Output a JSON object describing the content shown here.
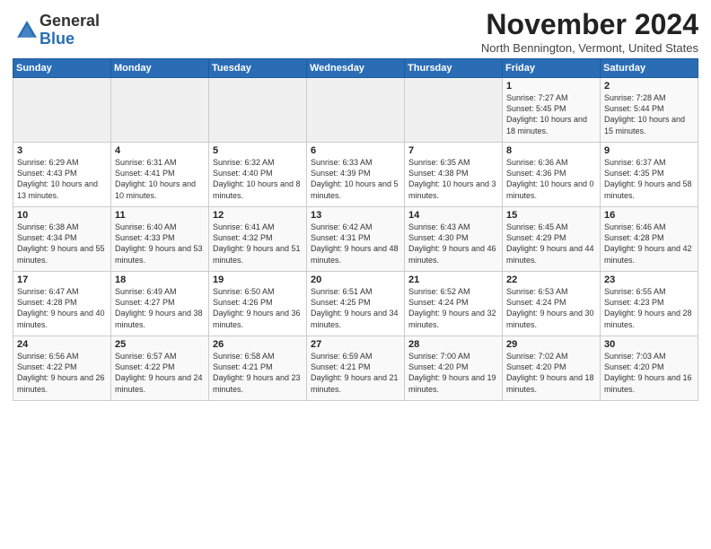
{
  "logo": {
    "general": "General",
    "blue": "Blue"
  },
  "title": "November 2024",
  "subtitle": "North Bennington, Vermont, United States",
  "days_header": [
    "Sunday",
    "Monday",
    "Tuesday",
    "Wednesday",
    "Thursday",
    "Friday",
    "Saturday"
  ],
  "weeks": [
    [
      {
        "num": "",
        "info": ""
      },
      {
        "num": "",
        "info": ""
      },
      {
        "num": "",
        "info": ""
      },
      {
        "num": "",
        "info": ""
      },
      {
        "num": "",
        "info": ""
      },
      {
        "num": "1",
        "info": "Sunrise: 7:27 AM\nSunset: 5:45 PM\nDaylight: 10 hours and 18 minutes."
      },
      {
        "num": "2",
        "info": "Sunrise: 7:28 AM\nSunset: 5:44 PM\nDaylight: 10 hours and 15 minutes."
      }
    ],
    [
      {
        "num": "3",
        "info": "Sunrise: 6:29 AM\nSunset: 4:43 PM\nDaylight: 10 hours and 13 minutes."
      },
      {
        "num": "4",
        "info": "Sunrise: 6:31 AM\nSunset: 4:41 PM\nDaylight: 10 hours and 10 minutes."
      },
      {
        "num": "5",
        "info": "Sunrise: 6:32 AM\nSunset: 4:40 PM\nDaylight: 10 hours and 8 minutes."
      },
      {
        "num": "6",
        "info": "Sunrise: 6:33 AM\nSunset: 4:39 PM\nDaylight: 10 hours and 5 minutes."
      },
      {
        "num": "7",
        "info": "Sunrise: 6:35 AM\nSunset: 4:38 PM\nDaylight: 10 hours and 3 minutes."
      },
      {
        "num": "8",
        "info": "Sunrise: 6:36 AM\nSunset: 4:36 PM\nDaylight: 10 hours and 0 minutes."
      },
      {
        "num": "9",
        "info": "Sunrise: 6:37 AM\nSunset: 4:35 PM\nDaylight: 9 hours and 58 minutes."
      }
    ],
    [
      {
        "num": "10",
        "info": "Sunrise: 6:38 AM\nSunset: 4:34 PM\nDaylight: 9 hours and 55 minutes."
      },
      {
        "num": "11",
        "info": "Sunrise: 6:40 AM\nSunset: 4:33 PM\nDaylight: 9 hours and 53 minutes."
      },
      {
        "num": "12",
        "info": "Sunrise: 6:41 AM\nSunset: 4:32 PM\nDaylight: 9 hours and 51 minutes."
      },
      {
        "num": "13",
        "info": "Sunrise: 6:42 AM\nSunset: 4:31 PM\nDaylight: 9 hours and 48 minutes."
      },
      {
        "num": "14",
        "info": "Sunrise: 6:43 AM\nSunset: 4:30 PM\nDaylight: 9 hours and 46 minutes."
      },
      {
        "num": "15",
        "info": "Sunrise: 6:45 AM\nSunset: 4:29 PM\nDaylight: 9 hours and 44 minutes."
      },
      {
        "num": "16",
        "info": "Sunrise: 6:46 AM\nSunset: 4:28 PM\nDaylight: 9 hours and 42 minutes."
      }
    ],
    [
      {
        "num": "17",
        "info": "Sunrise: 6:47 AM\nSunset: 4:28 PM\nDaylight: 9 hours and 40 minutes."
      },
      {
        "num": "18",
        "info": "Sunrise: 6:49 AM\nSunset: 4:27 PM\nDaylight: 9 hours and 38 minutes."
      },
      {
        "num": "19",
        "info": "Sunrise: 6:50 AM\nSunset: 4:26 PM\nDaylight: 9 hours and 36 minutes."
      },
      {
        "num": "20",
        "info": "Sunrise: 6:51 AM\nSunset: 4:25 PM\nDaylight: 9 hours and 34 minutes."
      },
      {
        "num": "21",
        "info": "Sunrise: 6:52 AM\nSunset: 4:24 PM\nDaylight: 9 hours and 32 minutes."
      },
      {
        "num": "22",
        "info": "Sunrise: 6:53 AM\nSunset: 4:24 PM\nDaylight: 9 hours and 30 minutes."
      },
      {
        "num": "23",
        "info": "Sunrise: 6:55 AM\nSunset: 4:23 PM\nDaylight: 9 hours and 28 minutes."
      }
    ],
    [
      {
        "num": "24",
        "info": "Sunrise: 6:56 AM\nSunset: 4:22 PM\nDaylight: 9 hours and 26 minutes."
      },
      {
        "num": "25",
        "info": "Sunrise: 6:57 AM\nSunset: 4:22 PM\nDaylight: 9 hours and 24 minutes."
      },
      {
        "num": "26",
        "info": "Sunrise: 6:58 AM\nSunset: 4:21 PM\nDaylight: 9 hours and 23 minutes."
      },
      {
        "num": "27",
        "info": "Sunrise: 6:59 AM\nSunset: 4:21 PM\nDaylight: 9 hours and 21 minutes."
      },
      {
        "num": "28",
        "info": "Sunrise: 7:00 AM\nSunset: 4:20 PM\nDaylight: 9 hours and 19 minutes."
      },
      {
        "num": "29",
        "info": "Sunrise: 7:02 AM\nSunset: 4:20 PM\nDaylight: 9 hours and 18 minutes."
      },
      {
        "num": "30",
        "info": "Sunrise: 7:03 AM\nSunset: 4:20 PM\nDaylight: 9 hours and 16 minutes."
      }
    ]
  ]
}
